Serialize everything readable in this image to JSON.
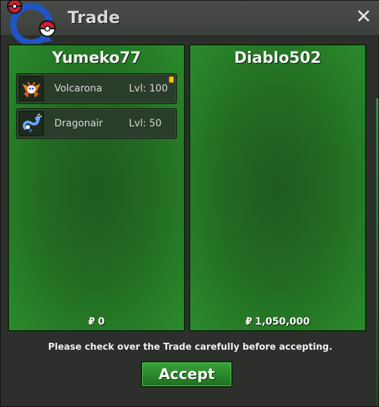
{
  "window": {
    "title": "Trade",
    "close_symbol": "✕",
    "logo_icon": "trade-arrows-pokeball-icon"
  },
  "left_panel": {
    "username": "Yumeko77",
    "money_symbol": "₽",
    "money": "0",
    "items": [
      {
        "name": "Volcarona",
        "level": "Lvl: 100",
        "flag": true,
        "icon": "volcarona-sprite-icon"
      },
      {
        "name": "Dragonair",
        "level": "Lvl: 50",
        "flag": false,
        "icon": "dragonair-sprite-icon"
      }
    ]
  },
  "right_panel": {
    "username": "Diablo502",
    "money_symbol": "₽",
    "money": "1,050,000",
    "items": []
  },
  "footer": {
    "notice": "Please check over the Trade carefully before accepting.",
    "accept_label": "Accept"
  },
  "colors": {
    "panel_green": "#226a22",
    "accept_green": "#2e8f2e",
    "title_text": "#d6d6d6"
  }
}
